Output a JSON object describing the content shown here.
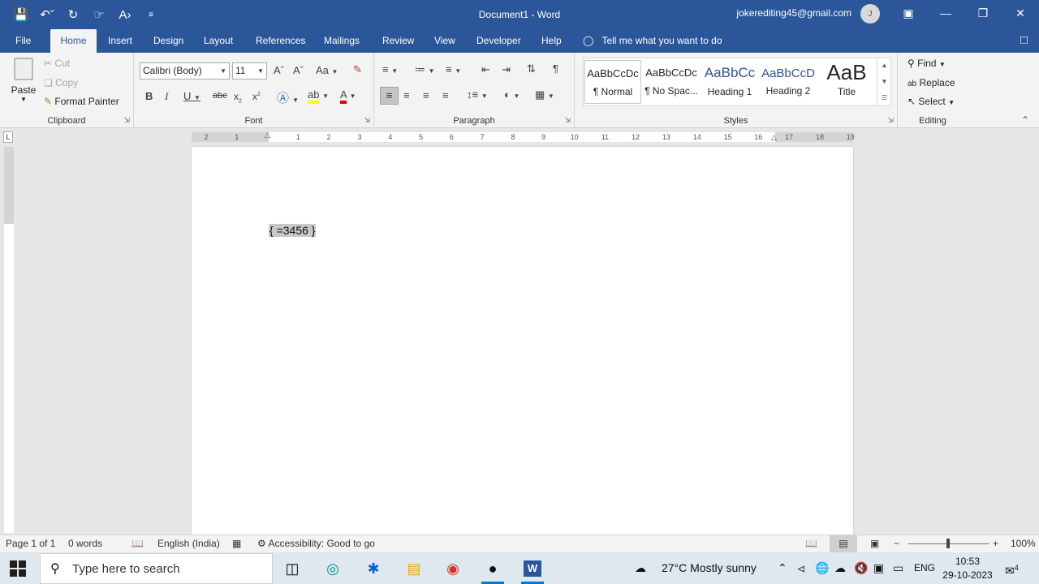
{
  "titlebar": {
    "doc_title": "Document1  -  Word",
    "account": "jokerediting45@gmail.com",
    "avatar_initial": "J"
  },
  "tabs": [
    "File",
    "Home",
    "Insert",
    "Design",
    "Layout",
    "References",
    "Mailings",
    "Review",
    "View",
    "Developer",
    "Help"
  ],
  "tell_me": "Tell me what you want to do",
  "clipboard": {
    "paste": "Paste",
    "cut": "Cut",
    "copy": "Copy",
    "format_painter": "Format Painter",
    "label": "Clipboard"
  },
  "font": {
    "name": "Calibri (Body)",
    "size": "11",
    "label": "Font",
    "case_label": "Aa"
  },
  "paragraph": {
    "label": "Paragraph"
  },
  "styles": {
    "items": [
      {
        "preview": "AaBbCcDc",
        "name": "¶ Normal"
      },
      {
        "preview": "AaBbCcDc",
        "name": "¶ No Spac..."
      },
      {
        "preview": "AaBbCc",
        "name": "Heading 1"
      },
      {
        "preview": "AaBbCcD",
        "name": "Heading 2"
      },
      {
        "preview": "AaB",
        "name": "Title"
      }
    ],
    "label": "Styles"
  },
  "editing": {
    "find": "Find",
    "replace": "Replace",
    "select": "Select",
    "label": "Editing"
  },
  "ruler": {
    "ticks": [
      "2",
      "1",
      "",
      "1",
      "2",
      "3",
      "4",
      "5",
      "6",
      "7",
      "8",
      "9",
      "10",
      "11",
      "12",
      "13",
      "14",
      "15",
      "16",
      "17",
      "18",
      "19"
    ]
  },
  "document": {
    "field_code": "{ =3456 }"
  },
  "statusbar": {
    "page": "Page 1 of 1",
    "words": "0 words",
    "language": "English (India)",
    "accessibility": "Accessibility: Good to go",
    "zoom": "100%"
  },
  "taskbar": {
    "search_placeholder": "Type here to search",
    "weather": "27°C  Mostly sunny",
    "lang": "ENG",
    "time": "10:53",
    "date": "29-10-2023",
    "notifications": "4"
  }
}
